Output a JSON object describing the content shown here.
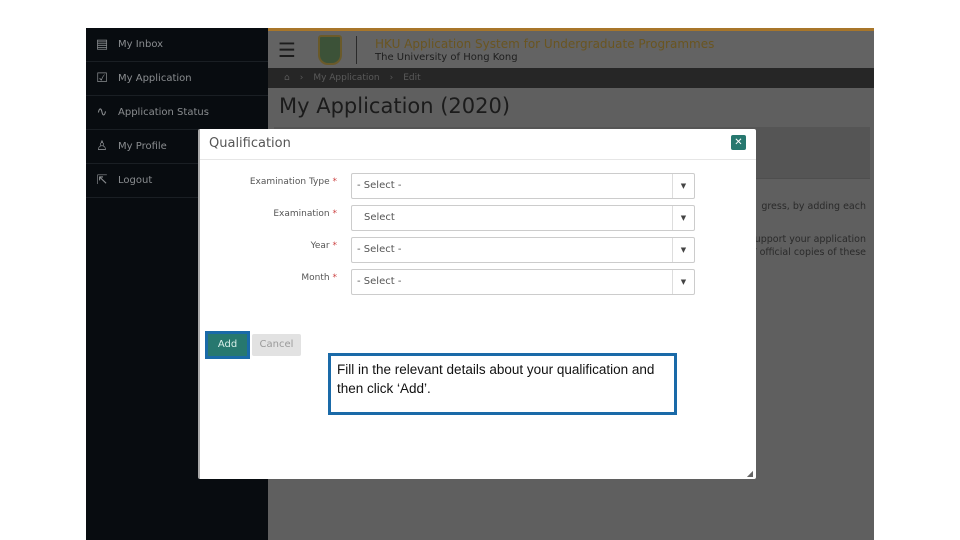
{
  "sidebar": {
    "items": [
      {
        "icon": "inbox-icon",
        "glyph": "▤",
        "label": "My Inbox"
      },
      {
        "icon": "checkbox-icon",
        "glyph": "☑",
        "label": "My Application"
      },
      {
        "icon": "pulse-icon",
        "glyph": "∿",
        "label": "Application Status"
      },
      {
        "icon": "user-icon",
        "glyph": "♙",
        "label": "My Profile"
      },
      {
        "icon": "logout-icon",
        "glyph": "⇱",
        "label": "Logout"
      }
    ]
  },
  "header": {
    "title": "HKU Application System for Undergraduate Programmes",
    "subtitle": "The University of Hong Kong"
  },
  "breadcrumb": {
    "items": [
      "My Application",
      "Edit"
    ]
  },
  "page": {
    "title": "My Application (2020)",
    "text1": "gress, by adding each",
    "text2a": "upport your application",
    "text2b": "/ official copies of these"
  },
  "modal": {
    "title": "Qualification",
    "fields": [
      {
        "label": "Examination Type",
        "value": "- Select -"
      },
      {
        "label": "Examination",
        "value": "Select"
      },
      {
        "label": "Year",
        "value": "- Select -"
      },
      {
        "label": "Month",
        "value": "- Select -"
      }
    ],
    "required_mark": "*",
    "add_label": "Add",
    "cancel_label": "Cancel"
  },
  "tooltip": {
    "text": "Fill in the relevant details about your qualification and then click ‘Add’."
  },
  "colors": {
    "accent": "#27786f",
    "highlight": "#1a6aa8",
    "sidebar": "#080c10"
  }
}
